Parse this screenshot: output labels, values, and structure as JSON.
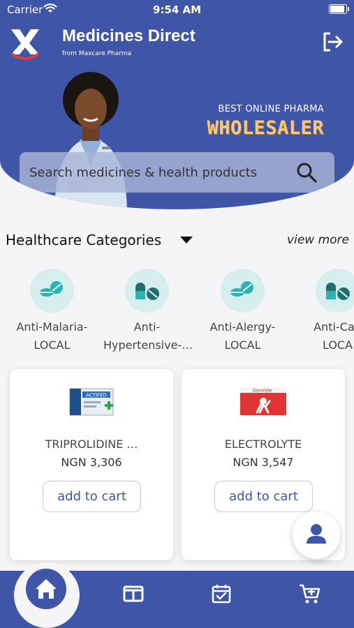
{
  "status_bar": {
    "carrier": "Carrier",
    "time": "9:54 AM"
  },
  "header": {
    "title": "Medicines Direct",
    "subtitle": "from Maxcare Pharma",
    "logout_icon": "logout-icon"
  },
  "banner": {
    "tagline": "BEST ONLINE PHARMA",
    "headline": "WHOLESALER"
  },
  "search": {
    "placeholder": "Search medicines & health products"
  },
  "categories_section": {
    "title": "Healthcare Categories",
    "view_more": "view more"
  },
  "categories": [
    {
      "line1": "Anti-Malaria-",
      "line2": "LOCAL"
    },
    {
      "line1": "Anti-",
      "line2": "Hypertensive-…"
    },
    {
      "line1": "Anti-Alergy-",
      "line2": "LOCAL"
    },
    {
      "line1": "Anti-Can",
      "line2": "LOCA"
    }
  ],
  "products": [
    {
      "name": "TRIPROLIDINE …",
      "price": "NGN 3,306",
      "button": "add to cart"
    },
    {
      "name": "ELECTROLYTE",
      "price": "NGN 3,547",
      "button": "add to cart"
    }
  ],
  "colors": {
    "primary": "#3f55a8",
    "accent": "#f7c97f",
    "teal": "#2bb3b1",
    "category_bg": "#d6eeee"
  },
  "bottom_nav": [
    "home-icon",
    "catalog-icon",
    "calendar-check-icon",
    "cart-add-icon"
  ]
}
